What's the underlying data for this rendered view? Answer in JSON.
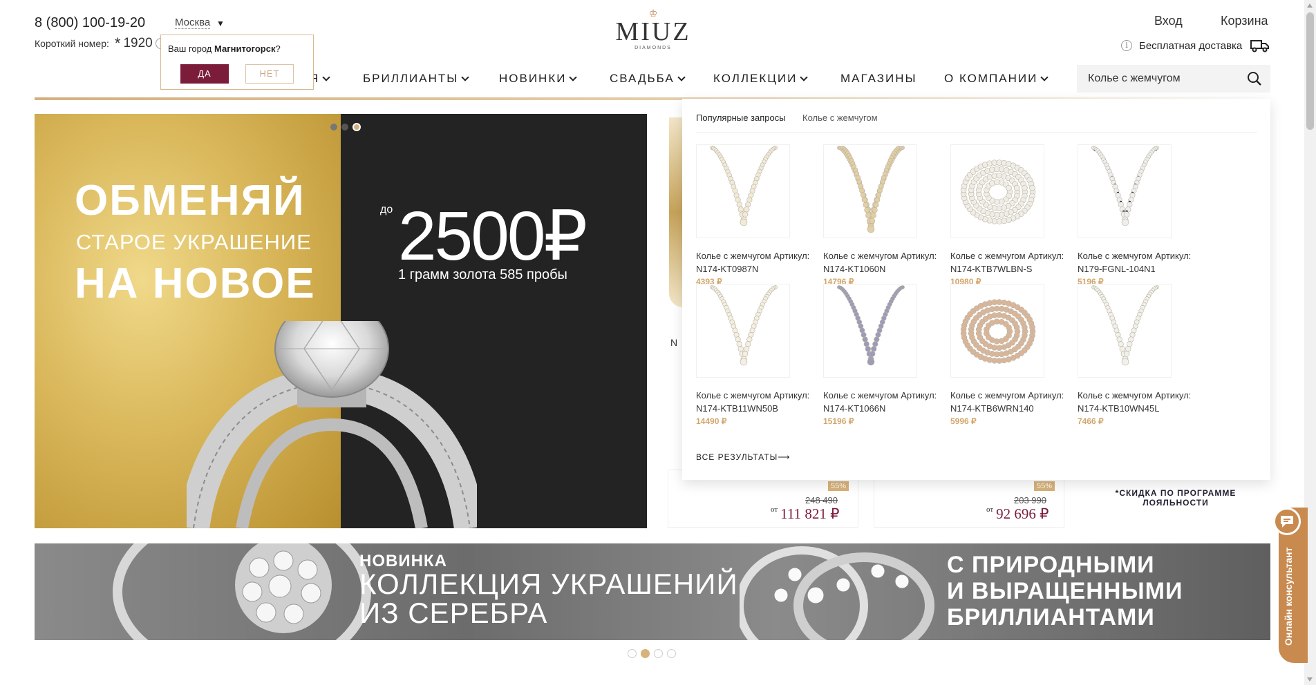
{
  "header": {
    "phone": "8 (800) 100-19-20",
    "short_label": "Короткий номер:",
    "short_star": "*",
    "short_num": "1920",
    "city": "Москва",
    "logo_word": "MIUZ",
    "logo_sub": "DIAMONDS",
    "login": "Вход",
    "cart": "Корзина",
    "delivery": "Бесплатная доставка"
  },
  "city_popup": {
    "question_prefix": "Ваш город ",
    "city": "Магнитогорск",
    "question_suffix": "?",
    "yes": "ДА",
    "no": "НЕТ"
  },
  "nav": {
    "stub": "Я",
    "items": [
      "БРИЛЛИАНТЫ",
      "НОВИНКИ",
      "СВАДЬБА",
      "КОЛЛЕКЦИИ",
      "МАГАЗИНЫ",
      "О КОМПАНИИ"
    ]
  },
  "search": {
    "value": "Колье с жемчугом"
  },
  "hero": {
    "line1": "ОБМЕНЯЙ",
    "line2": "СТАРОЕ УКРАШЕНИЕ",
    "line3": "НА НОВОЕ",
    "do": "до",
    "amount": "2500₽",
    "gram": "1 грамм золота 585 пробы"
  },
  "dropdown": {
    "popular_label": "Популярные запросы",
    "popular_query": "Колье с жемчугом",
    "all_results": "ВСЕ РЕЗУЛЬТАТЫ⟶",
    "products": [
      {
        "name": "Колье с жемчугом Артикул: N174-KT0987N",
        "price": "4393 ₽",
        "pearl": "#f1ead8",
        "style": "strand"
      },
      {
        "name": "Колье с жемчугом Артикул: N174-KT1060N",
        "price": "14796 ₽",
        "pearl": "#e2cfa4",
        "style": "double"
      },
      {
        "name": "Колье с жемчугом Артикул: N174-KTB7WLBN-S",
        "price": "10980 ₽",
        "pearl": "#efede6",
        "style": "coil"
      },
      {
        "name": "Колье с жемчугом Артикул: N179-FGNL-104N1",
        "price": "5196 ₽",
        "pearl": "#eeeeee",
        "style": "dark"
      },
      {
        "name": "Колье с жемчугом Артикул: N174-KTB11WN50B",
        "price": "14490 ₽",
        "pearl": "#f4efe2",
        "style": "strand"
      },
      {
        "name": "Колье с жемчугом Артикул: N174-KT1066N",
        "price": "15196 ₽",
        "pearl": "#9c9cb8",
        "style": "strand"
      },
      {
        "name": "Колье с жемчугом Артикул: N174-KTB6WRN140",
        "price": "5996 ₽",
        "pearl": "#d9b69a",
        "style": "coil"
      },
      {
        "name": "Колье с жемчугом Артикул: N174-KTB10WN45L",
        "price": "7466 ₽",
        "pearl": "#f2f0ea",
        "style": "strand"
      }
    ]
  },
  "behind": {
    "n_letter": "N",
    "card1": {
      "badge": "55%",
      "old": "248 490",
      "from": "от",
      "price": "111 821 ₽"
    },
    "card2": {
      "badge": "55%",
      "old": "203 990",
      "from": "от",
      "price": "92 696 ₽"
    },
    "loyalty": "*СКИДКА ПО ПРОГРАММЕ ЛОЯЛЬНОСТИ"
  },
  "banner2": {
    "new": "НОВИНКА",
    "col1": "КОЛЛЕКЦИЯ УКРАШЕНИЙ",
    "col2": "ИЗ СЕРЕБРА",
    "r1": "С ПРИРОДНЫМИ",
    "r2": "И ВЫРАЩЕННЫМИ",
    "r3": "БРИЛЛИАНТАМИ"
  },
  "consultant": "Онлайн консультант",
  "colors": {
    "accent": "#7b1c3a",
    "gold": "#d2a66b",
    "consult": "#c98a4f"
  }
}
